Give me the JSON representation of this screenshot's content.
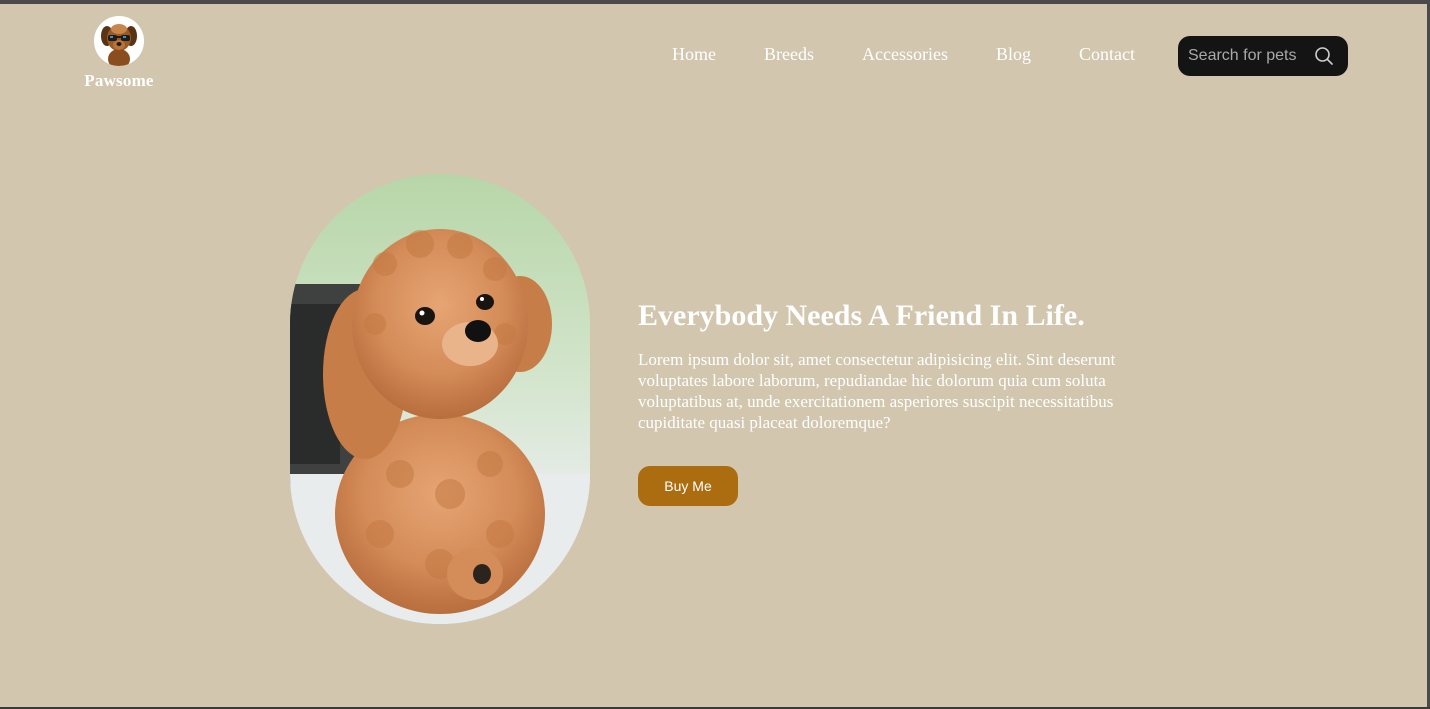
{
  "brand": {
    "name": "Pawsome"
  },
  "nav": {
    "items": [
      "Home",
      "Breeds",
      "Accessories",
      "Blog",
      "Contact"
    ]
  },
  "search": {
    "placeholder": "Search for pets"
  },
  "hero": {
    "title": "Everybody Needs A Friend In Life.",
    "description": "Lorem ipsum dolor sit, amet consectetur adipisicing elit. Sint deserunt voluptates labore laborum, repudiandae hic dolorum quia cum soluta voluptatibus at, unde exercitationem asperiores suscipit necessitatibus cupiditate quasi placeat doloremque?",
    "button_label": "Buy Me"
  },
  "colors": {
    "background": "#d2c6ae",
    "accent": "#ac6c10",
    "search_bg": "#141414",
    "text": "#ffffff"
  },
  "icons": {
    "logo": "dog-with-sunglasses-logo",
    "search": "search-icon"
  }
}
